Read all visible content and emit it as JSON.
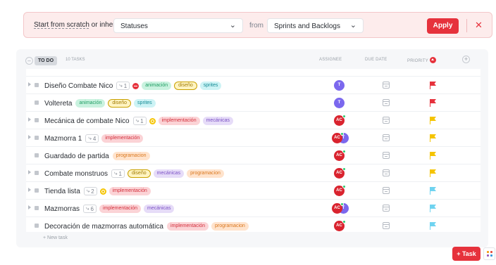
{
  "inherit": {
    "label_link": "Start from scratch",
    "label_rest": " or inherit:",
    "select1": "Statuses",
    "from": "from",
    "select2": "Sprints and Backlogs",
    "apply": "Apply",
    "close": "✕"
  },
  "group": {
    "status": "TO DO",
    "count": "10 TASKS",
    "col_assignee": "ASSIGNEE",
    "col_due": "DUE DATE",
    "col_priority": "PRIORITY",
    "add_column": "+",
    "collapse": "–"
  },
  "tasks": [
    {
      "name": "Diseño Combate Nico",
      "subtasks": "1",
      "status_icon": "blocked",
      "tags": [
        "animación",
        "diseño",
        "sprites"
      ],
      "assignees": [
        "T"
      ],
      "priority": "urgent"
    },
    {
      "name": "Voltereta",
      "subtasks": "",
      "status_icon": "",
      "tags": [
        "animación",
        "diseño",
        "sprites"
      ],
      "assignees": [
        "T"
      ],
      "priority": "urgent"
    },
    {
      "name": "Mecánica de combate Nico",
      "subtasks": "1",
      "status_icon": "in-progress",
      "tags": [
        "implementación",
        "mecánicas"
      ],
      "assignees": [
        "AC"
      ],
      "priority": "high"
    },
    {
      "name": "Mazmorra 1",
      "subtasks": "4",
      "status_icon": "",
      "tags": [
        "implementación"
      ],
      "assignees": [
        "AC",
        "T"
      ],
      "priority": "high"
    },
    {
      "name": "Guardado de partida",
      "subtasks": "",
      "status_icon": "",
      "tags": [
        "programacion"
      ],
      "assignees": [
        "AC"
      ],
      "priority": "high"
    },
    {
      "name": "Combate monstruos",
      "subtasks": "1",
      "status_icon": "",
      "tags": [
        "diseño",
        "mecánicas",
        "programacion"
      ],
      "assignees": [
        "AC"
      ],
      "priority": "high"
    },
    {
      "name": "Tienda lista",
      "subtasks": "2",
      "status_icon": "in-progress",
      "tags": [
        "implementación"
      ],
      "assignees": [
        "AC"
      ],
      "priority": "normal"
    },
    {
      "name": "Mazmorras",
      "subtasks": "6",
      "status_icon": "",
      "tags": [
        "implementación",
        "mecánicas"
      ],
      "assignees": [
        "AC",
        "T"
      ],
      "priority": "normal"
    },
    {
      "name": "Decoración de mazmorras automática",
      "subtasks": "",
      "status_icon": "",
      "tags": [
        "implementación",
        "programacion"
      ],
      "assignees": [
        "AC"
      ],
      "priority": "normal"
    }
  ],
  "new_task": "+ New task",
  "fab": {
    "task": "+ Task"
  },
  "colors": {
    "accent_red": "#e6323c",
    "urgent": "#e6323c",
    "high": "#f5c400",
    "normal": "#6fd3f0",
    "avatar_t": "#7b68ee",
    "avatar_ac": "#d9232e"
  }
}
